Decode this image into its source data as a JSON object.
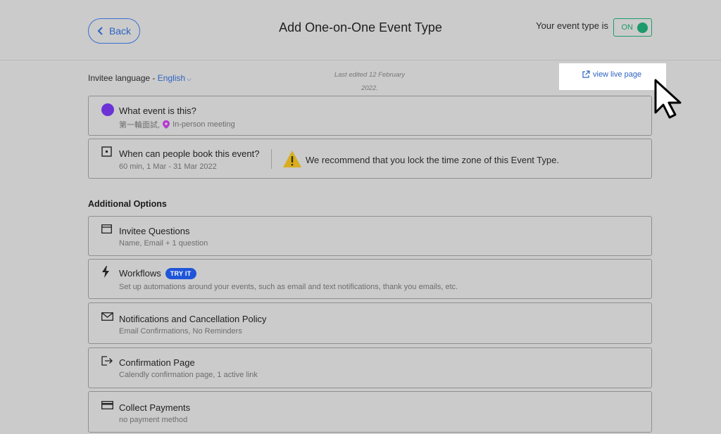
{
  "header": {
    "back_label": "Back",
    "title": "Add One-on-One Event Type",
    "status_label": "Your event type is",
    "toggle_label": "ON",
    "toggle_color": "#1d9b6a"
  },
  "subheader": {
    "language_prefix": "Invitee language - ",
    "language_value": "English",
    "last_edited_line1": "Last edited 12 February",
    "last_edited_line2": "2022.",
    "view_live_label": "view live page"
  },
  "what_event": {
    "title": "What event is this?",
    "event_name": "第一輪面試,",
    "location": "In-person meeting",
    "dot_color": "#6b33d6"
  },
  "when_event": {
    "title": "When can people book this event?",
    "subtitle": "60 min, 1 Mar - 31 Mar 2022",
    "warning": "We recommend that you lock the time zone of this Event Type."
  },
  "additional": {
    "section_title": "Additional Options",
    "items": [
      {
        "title": "Invitee Questions",
        "subtitle": "Name, Email + 1 question",
        "icon": "form-icon"
      },
      {
        "title": "Workflows",
        "badge": "TRY IT",
        "subtitle": "Set up automations around your events, such as email and text notifications, thank you emails, etc.",
        "icon": "lightning-icon"
      },
      {
        "title": "Notifications and Cancellation Policy",
        "subtitle": "Email Confirmations, No Reminders",
        "icon": "envelope-icon"
      },
      {
        "title": "Confirmation Page",
        "subtitle": "Calendly confirmation page, 1 active link",
        "icon": "exit-arrow-icon"
      },
      {
        "title": "Collect Payments",
        "subtitle": "no payment method",
        "icon": "credit-card-icon"
      }
    ]
  },
  "colors": {
    "accent": "#2f63c2",
    "badge": "#1f55d8",
    "warning": "#d8ad1e"
  }
}
